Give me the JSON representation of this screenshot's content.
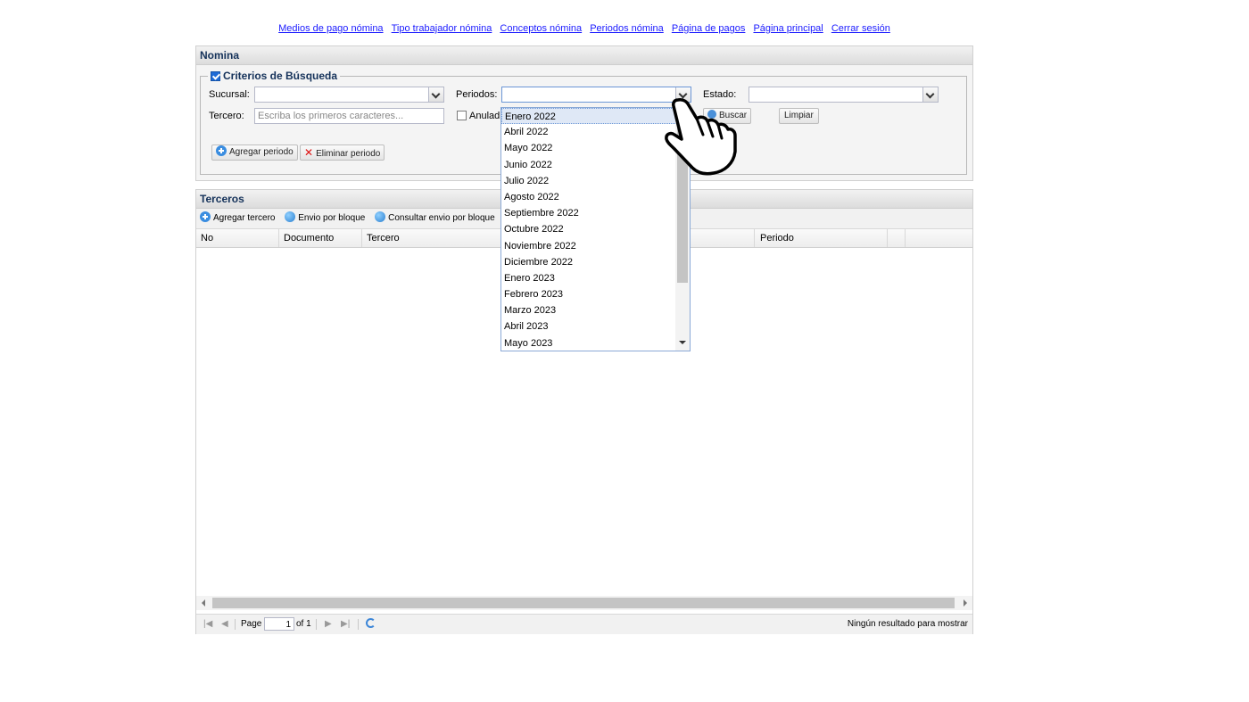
{
  "topnav": {
    "links": [
      "Medios de pago nómina",
      "Tipo trabajador nómina",
      "Conceptos nómina",
      "Periodos nómina",
      "Página de pagos",
      "Página principal",
      "Cerrar sesión"
    ]
  },
  "nomina": {
    "title": "Nomina",
    "criterios_title": "Criterios de Búsqueda",
    "sucursal_label": "Sucursal:",
    "periodos_label": "Periodos:",
    "estado_label": "Estado:",
    "tercero_label": "Tercero:",
    "tercero_placeholder": "Escriba los primeros caracteres...",
    "anulados_label": "Anulad",
    "buscar_label": "Buscar",
    "limpiar_label": "Limpiar",
    "agregar_periodo_label": "Agregar periodo",
    "eliminar_periodo_label": "Eliminar periodo"
  },
  "periodos_dropdown": {
    "items": [
      "Enero 2022",
      "Abril 2022",
      "Mayo 2022",
      "Junio 2022",
      "Julio 2022",
      "Agosto 2022",
      "Septiembre 2022",
      "Octubre 2022",
      "Noviembre 2022",
      "Diciembre 2022",
      "Enero 2023",
      "Febrero 2023",
      "Marzo 2023",
      "Abril 2023",
      "Mayo 2023"
    ],
    "selected": "Enero 2022"
  },
  "terceros": {
    "title": "Terceros",
    "toolbar": {
      "agregar": "Agregar tercero",
      "envio_bloque": "Envio por bloque",
      "consultar_envio": "Consultar envio por bloque"
    },
    "columns": [
      "No",
      "Documento",
      "Tercero",
      "Periodo"
    ],
    "pager": {
      "page_label": "Page",
      "page_value": "1",
      "of_label": "of 1",
      "status": "Ningún resultado para mostrar"
    }
  },
  "colors": {
    "link": "#1a1aff",
    "header_text": "#15325a",
    "focus_border": "#6b96d6"
  },
  "icons": [
    "plus-circle-icon",
    "x-icon",
    "send-icon",
    "search-icon",
    "refresh-icon",
    "pointing-hand-icon"
  ]
}
